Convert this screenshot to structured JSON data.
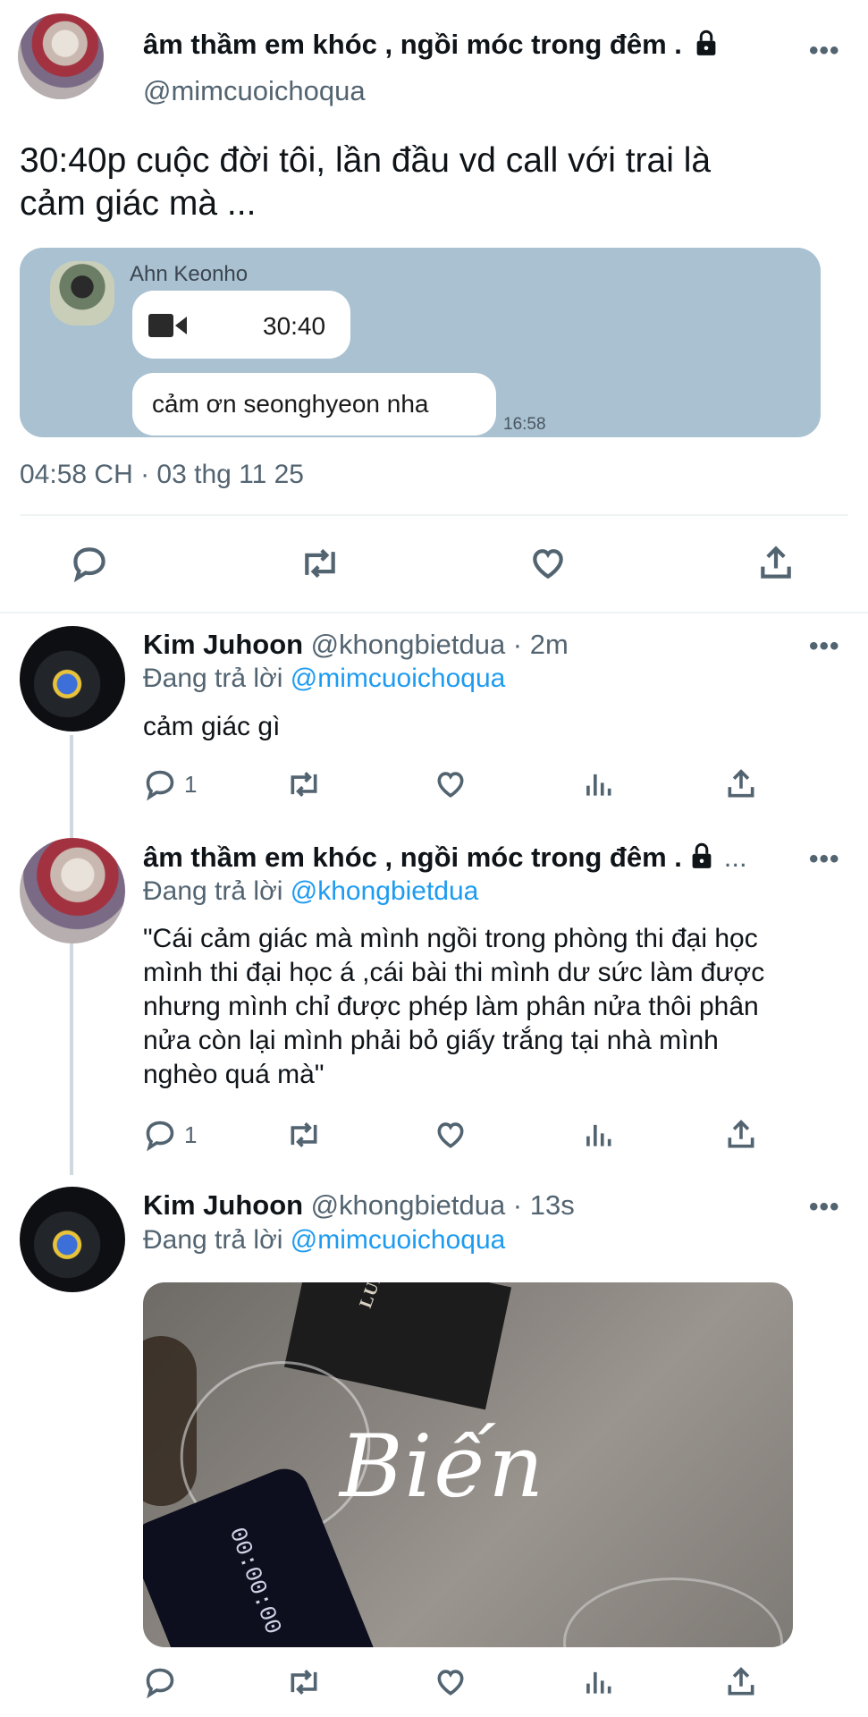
{
  "main_tweet": {
    "display_name": "âm thầm em khóc , ngồi móc trong đêm .",
    "handle": "@mimcuoichoqua",
    "text_line1": "30:40p cuộc đời tôi, lần đầu vd call với trai là",
    "text_line2": "cảm giác mà ...",
    "embedded_chat": {
      "contact_name": "Ahn Keonho",
      "call_duration": "30:40",
      "message": "cảm ơn seonghyeon nha",
      "time": "16:58",
      "bg_color": "#a9c1d1"
    },
    "timestamp": "04:58 CH · 03 thg 11 25"
  },
  "replies": [
    {
      "display_name": "Kim Juhoon",
      "handle_time": "@khongbietdua · 2m",
      "replying_prefix": "Đang trả lời",
      "replying_to": "@mimcuoichoqua",
      "text_lines": [
        "cảm giác gì"
      ],
      "reply_count": "1"
    },
    {
      "display_name": "âm thầm em khóc , ngồi móc trong đêm .",
      "handle_time": "...",
      "replying_prefix": "Đang trả lời",
      "replying_to": "@khongbietdua",
      "text_lines": [
        "\"Cái cảm giác mà mình ngồi trong phòng thi đại học",
        "mình thi đại học á ,cái bài thi mình dư sức làm được",
        "nhưng mình chỉ được phép làm phân nửa thôi phân",
        "nửa còn lại mình phải bỏ giấy trắng tại nhà mình",
        "nghèo quá mà\""
      ],
      "reply_count": "1"
    },
    {
      "display_name": "Kim Juhoon",
      "handle_time": "@khongbietdua · 13s",
      "replying_prefix": "Đang trả lời",
      "replying_to": "@mimcuoichoqua",
      "image_overlay_text": "Biến",
      "image_label_text": "LUPIN WOLF",
      "image_phone_text": "00:00:00",
      "reply_count": ""
    }
  ],
  "colors": {
    "accent": "#1d9bf0",
    "muted": "#536471",
    "text": "#0f1419"
  }
}
